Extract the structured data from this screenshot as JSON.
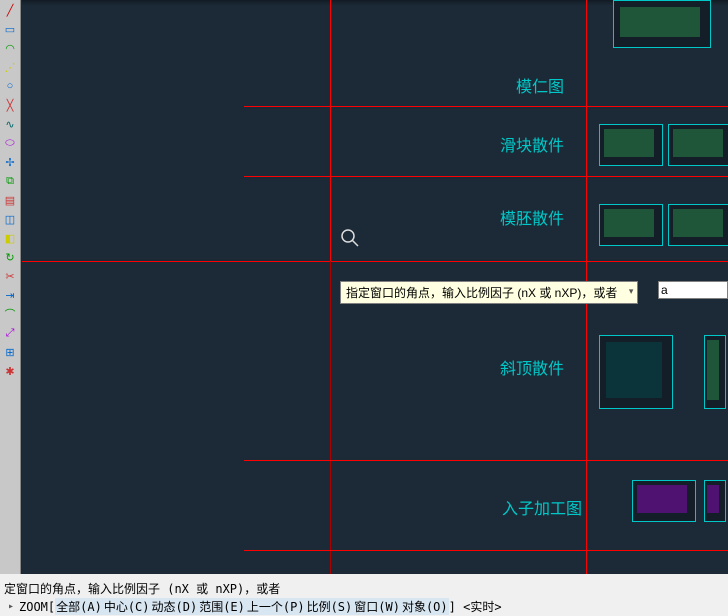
{
  "toolbar": {
    "tools": [
      {
        "name": "line-tool",
        "glyph": "╱",
        "color": "#c00"
      },
      {
        "name": "rect-tool",
        "glyph": "▭",
        "color": "#06c"
      },
      {
        "name": "arc-tool",
        "glyph": "◠",
        "color": "#090"
      },
      {
        "name": "yellow-tool",
        "glyph": "⋰",
        "color": "#cc0"
      },
      {
        "name": "circle-tool",
        "glyph": "○",
        "color": "#06c"
      },
      {
        "name": "construction-line-tool",
        "glyph": "╳",
        "color": "#c33"
      },
      {
        "name": "polyline-tool",
        "glyph": "∿",
        "color": "#066"
      },
      {
        "name": "ellipse-tool",
        "glyph": "⬭",
        "color": "#a0d"
      },
      {
        "name": "move-tool",
        "glyph": "✢",
        "color": "#06c"
      },
      {
        "name": "copy-tool",
        "glyph": "⧉",
        "color": "#090"
      },
      {
        "name": "hatch-tool",
        "glyph": "▤",
        "color": "#c33"
      },
      {
        "name": "offset-tool",
        "glyph": "◫",
        "color": "#06c"
      },
      {
        "name": "mirror-tool",
        "glyph": "◧",
        "color": "#cc0"
      },
      {
        "name": "rotate-tool",
        "glyph": "↻",
        "color": "#090"
      },
      {
        "name": "trim-tool",
        "glyph": "✂",
        "color": "#c33"
      },
      {
        "name": "extend-tool",
        "glyph": "⇥",
        "color": "#06c"
      },
      {
        "name": "fillet-tool",
        "glyph": "⌒",
        "color": "#090"
      },
      {
        "name": "scale-tool",
        "glyph": "⤢",
        "color": "#a0d"
      },
      {
        "name": "array-tool",
        "glyph": "⊞",
        "color": "#06c"
      },
      {
        "name": "explode-tool",
        "glyph": "✱",
        "color": "#c33"
      }
    ]
  },
  "drawing": {
    "sections": {
      "mouren": {
        "label": "模仁图"
      },
      "huakuai": {
        "label": "滑块散件"
      },
      "mopi": {
        "label": "模胚散件"
      },
      "xieding": {
        "label": "斜顶散件"
      },
      "ruzi": {
        "label": "入子加工图"
      }
    }
  },
  "cursor": {
    "tooltip_text": "指定窗口的角点，输入比例因子 (nX 或 nXP)，或者",
    "tooltip_arrow": "▾",
    "input_value": "a"
  },
  "cmdbar": {
    "line1": "定窗口的角点，输入比例因子 (nX 或 nXP)，或者",
    "prompt_arrow": "▸",
    "cmd_name": " ZOOM ",
    "bracket_open": "[",
    "options": [
      {
        "label": "全部(A)"
      },
      {
        "label": "中心(C)"
      },
      {
        "label": "动态(D)"
      },
      {
        "label": "范围(E)"
      },
      {
        "label": "上一个(P)"
      },
      {
        "label": "比例(S)"
      },
      {
        "label": "窗口(W)"
      },
      {
        "label": "对象(O)"
      }
    ],
    "bracket_close": "] <实时>"
  }
}
